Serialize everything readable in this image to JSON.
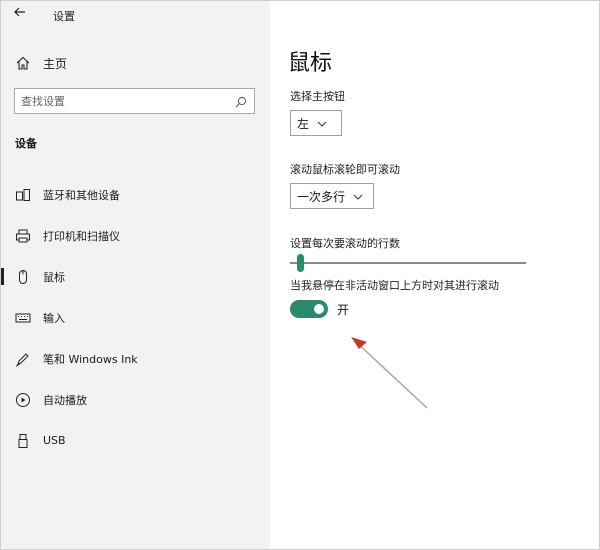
{
  "window": {
    "title": "设置"
  },
  "sidebar": {
    "home_label": "主页",
    "search": {
      "placeholder": "查找设置"
    },
    "section_title": "设备",
    "items": [
      {
        "label": "蓝牙和其他设备",
        "icon": "bluetooth-devices-icon",
        "active": false
      },
      {
        "label": "打印机和扫描仪",
        "icon": "printer-icon",
        "active": false
      },
      {
        "label": "鼠标",
        "icon": "mouse-icon",
        "active": true
      },
      {
        "label": "输入",
        "icon": "keyboard-icon",
        "active": false
      },
      {
        "label": "笔和 Windows Ink",
        "icon": "pen-icon",
        "active": false
      },
      {
        "label": "自动播放",
        "icon": "autoplay-icon",
        "active": false
      },
      {
        "label": "USB",
        "icon": "usb-icon",
        "active": false
      }
    ]
  },
  "main": {
    "title": "鼠标",
    "primary_button": {
      "label": "选择主按钮",
      "value": "左"
    },
    "scroll_mode": {
      "label": "滚动鼠标滚轮即可滚动",
      "value": "一次多行"
    },
    "scroll_lines": {
      "label": "设置每次要滚动的行数",
      "value_fraction": 0.03
    },
    "inactive_scroll": {
      "label": "当我悬停在非活动窗口上方时对其进行滚动",
      "state_label": "开",
      "on": true
    }
  },
  "colors": {
    "accent": "#2a8a6c",
    "annotation_arrow": "#c0392b",
    "sidebar_bg": "#f2f2f2"
  }
}
